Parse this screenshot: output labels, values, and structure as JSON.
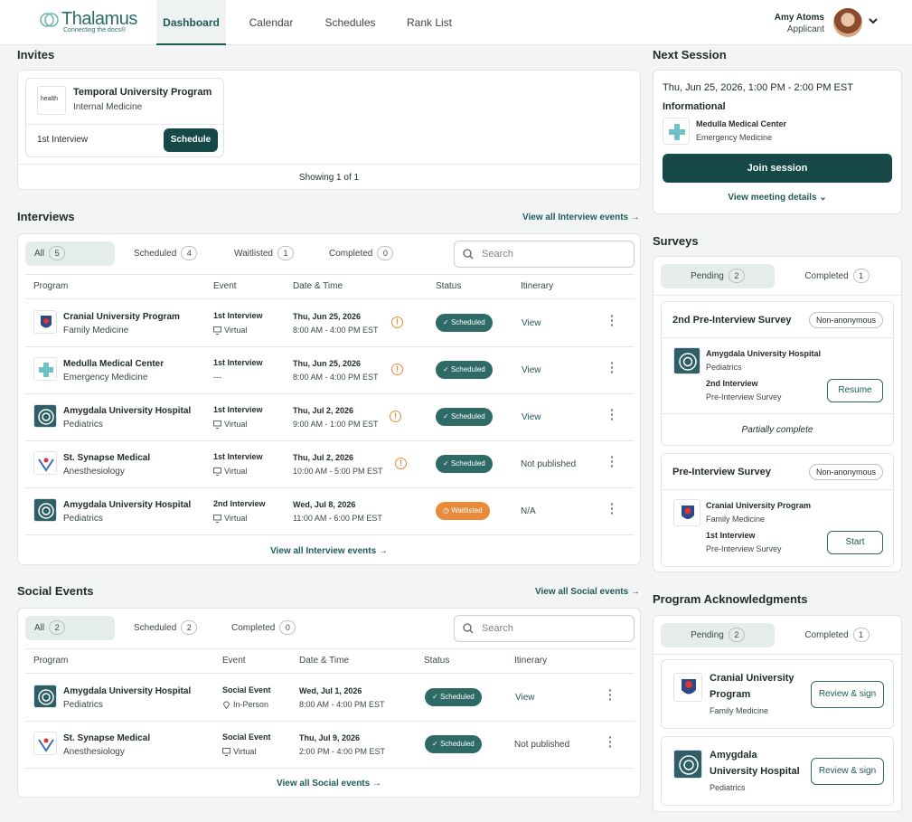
{
  "header": {
    "logo_name": "Thalamus",
    "logo_tagline": "Connecting the docs®",
    "nav": [
      "Dashboard",
      "Calendar",
      "Schedules",
      "Rank List"
    ],
    "user_name": "Amy Atoms",
    "user_role": "Applicant"
  },
  "invites": {
    "title": "Invites",
    "program": "Temporal University Program",
    "specialty": "Internal Medicine",
    "logo_text": "health",
    "event": "1st Interview",
    "button": "Schedule",
    "showing": "Showing 1 of 1"
  },
  "interviews": {
    "title": "Interviews",
    "view_all_top": "View all Interview events →",
    "view_all_bottom": "View all Interview events →",
    "tabs": [
      {
        "label": "All",
        "count": "5"
      },
      {
        "label": "Scheduled",
        "count": "4"
      },
      {
        "label": "Waitlisted",
        "count": "1"
      },
      {
        "label": "Completed",
        "count": "0"
      }
    ],
    "search_placeholder": "Search",
    "columns": [
      "Program",
      "Event",
      "Date & Time",
      "Status",
      "Itinerary"
    ],
    "rows": [
      {
        "program": "Cranial University Program",
        "specialty": "Family Medicine",
        "event": "1st Interview",
        "mode": "Virtual",
        "date": "Thu, Jun 25, 2026",
        "time": "8:00 AM - 4:00 PM EST",
        "status": "Scheduled",
        "itinerary": "View"
      },
      {
        "program": "Medulla Medical Center",
        "specialty": "Emergency Medicine",
        "event": "1st Interview",
        "mode": "---",
        "date": "Thu, Jun 25, 2026",
        "time": "8:00 AM - 4:00 PM EST",
        "status": "Scheduled",
        "itinerary": "View"
      },
      {
        "program": "Amygdala University Hospital",
        "specialty": "Pediatrics",
        "event": "1st Interview",
        "mode": "Virtual",
        "date": "Thu, Jul 2, 2026",
        "time": "9:00 AM - 1:00 PM EST",
        "status": "Scheduled",
        "itinerary": "View"
      },
      {
        "program": "St. Synapse Medical",
        "specialty": "Anesthesiology",
        "event": "1st Interview",
        "mode": "Virtual",
        "date": "Thu, Jul 2, 2026",
        "time": "10:00 AM - 5:00 PM EST",
        "status": "Scheduled",
        "itinerary": "Not published"
      },
      {
        "program": "Amygdala University Hospital",
        "specialty": "Pediatrics",
        "event": "2nd Interview",
        "mode": "Virtual",
        "date": "Wed, Jul 8, 2026",
        "time": "11:00 AM - 6:00 PM EST",
        "status": "Waitlisted",
        "itinerary": "N/A"
      }
    ]
  },
  "social": {
    "title": "Social Events",
    "view_all_top": "View all Social events →",
    "view_all_bottom": "View all Social events →",
    "tabs": [
      {
        "label": "All",
        "count": "2"
      },
      {
        "label": "Scheduled",
        "count": "2"
      },
      {
        "label": "Completed",
        "count": "0"
      }
    ],
    "search_placeholder": "Search",
    "columns": [
      "Program",
      "Event",
      "Date & Time",
      "Status",
      "Itinerary"
    ],
    "rows": [
      {
        "program": "Amygdala University Hospital",
        "specialty": "Pediatrics",
        "event": "Social Event",
        "mode": "In-Person",
        "date": "Wed, Jul 1, 2026",
        "time": "8:00 AM - 4:00 PM EST",
        "status": "Scheduled",
        "itinerary": "View"
      },
      {
        "program": "St. Synapse Medical",
        "specialty": "Anesthesiology",
        "event": "Social Event",
        "mode": "Virtual",
        "date": "Thu, Jul 9, 2026",
        "time": "2:00 PM - 4:00 PM EST",
        "status": "Scheduled",
        "itinerary": "Not published"
      }
    ]
  },
  "next_session": {
    "title": "Next Session",
    "datetime": "Thu, Jun 25, 2026, 1:00 PM - 2:00 PM EST",
    "type": "Informational",
    "program": "Medulla Medical Center",
    "specialty": "Emergency Medicine",
    "join": "Join session",
    "details": "View meeting details ⌄"
  },
  "surveys": {
    "title": "Surveys",
    "tabs": [
      {
        "label": "Pending",
        "count": "2"
      },
      {
        "label": "Completed",
        "count": "1"
      }
    ],
    "items": [
      {
        "title": "2nd Pre-Interview Survey",
        "tag": "Non-anonymous",
        "program": "Amygdala University Hospital",
        "specialty": "Pediatrics",
        "event": "2nd Interview",
        "sub": "Pre-Interview Survey",
        "button": "Resume",
        "note": "Partially complete"
      },
      {
        "title": "Pre-Interview Survey",
        "tag": "Non-anonymous",
        "program": "Cranial University Program",
        "specialty": "Family Medicine",
        "event": "1st Interview",
        "sub": "Pre-Interview Survey",
        "button": "Start"
      }
    ]
  },
  "acknowledgments": {
    "title": "Program Acknowledgments",
    "tabs": [
      {
        "label": "Pending",
        "count": "2"
      },
      {
        "label": "Completed",
        "count": "1"
      }
    ],
    "items": [
      {
        "program_line1": "Cranial University",
        "program_line2": "Program",
        "specialty": "Family Medicine",
        "button": "Review & sign"
      },
      {
        "program_line1": "Amygdala",
        "program_line2": "University Hospital",
        "specialty": "Pediatrics",
        "button": "Review & sign"
      }
    ]
  },
  "colors": {
    "primary": "#154847",
    "scheduled": "#2e6a66",
    "waitlisted": "#e88a3a",
    "background": "#f3f4f4"
  }
}
